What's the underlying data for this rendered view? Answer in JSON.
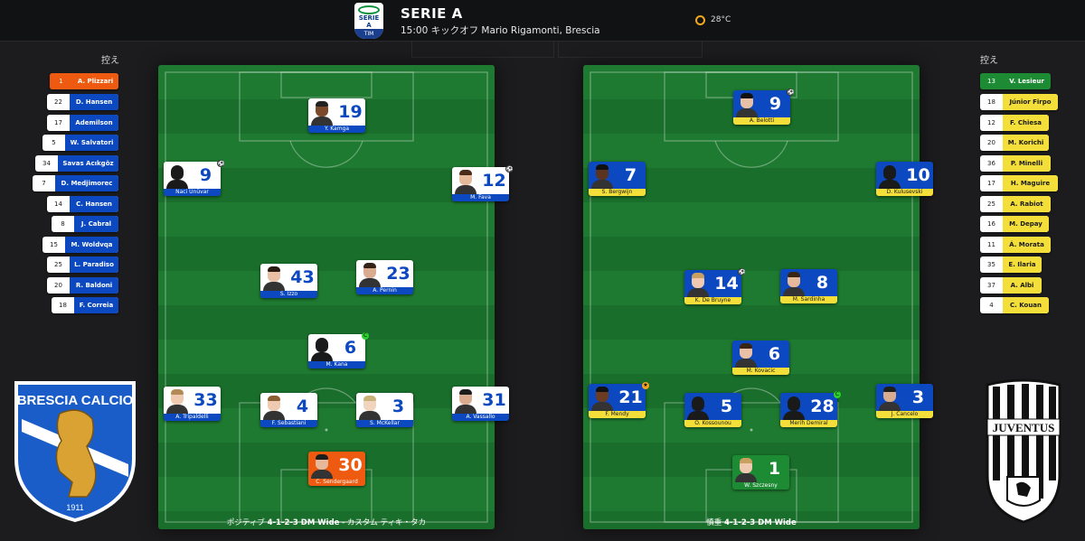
{
  "header": {
    "competition": "SERIE A",
    "kickoff": "15:00 キックオフ Mario Rigamonti, Brescia",
    "temperature": "28°C",
    "league_logo_text": "SERIE A",
    "league_logo_sponsor": "TIM"
  },
  "home": {
    "bench_label": "控え",
    "crest_text": "BRESCIA CALCIO",
    "crest_year": "1911",
    "formation_prefix": "ポジティブ",
    "formation": "4-1-2-3 DM Wide",
    "formation_suffix": "- カスタム ティキ・タカ",
    "subs": [
      {
        "num": "1",
        "name": "A. Plizzari",
        "style": "orange"
      },
      {
        "num": "22",
        "name": "D. Hansen",
        "style": "blue"
      },
      {
        "num": "17",
        "name": "Ademilson",
        "style": "blue"
      },
      {
        "num": "5",
        "name": "W. Salvatori",
        "style": "blue"
      },
      {
        "num": "34",
        "name": "Savas Acıkgöz",
        "style": "blue"
      },
      {
        "num": "7",
        "name": "D. Medjimorec",
        "style": "blue"
      },
      {
        "num": "14",
        "name": "C. Hansen",
        "style": "blue"
      },
      {
        "num": "8",
        "name": "J. Cabral",
        "style": "blue"
      },
      {
        "num": "15",
        "name": "M. Woldvqa",
        "style": "blue"
      },
      {
        "num": "25",
        "name": "L. Paradiso",
        "style": "blue"
      },
      {
        "num": "20",
        "name": "R. Baldoni",
        "style": "blue"
      },
      {
        "num": "18",
        "name": "F. Correia",
        "style": "blue"
      }
    ],
    "players": [
      {
        "num": "19",
        "name": "Y. Kamga"
      },
      {
        "num": "9",
        "name": "Naci Ünüvar"
      },
      {
        "num": "12",
        "name": "M. Fava"
      },
      {
        "num": "43",
        "name": "S. Izzo"
      },
      {
        "num": "23",
        "name": "A. Pernin"
      },
      {
        "num": "6",
        "name": "M. Kana"
      },
      {
        "num": "33",
        "name": "A. Tripaldelli"
      },
      {
        "num": "4",
        "name": "F. Sebastiani"
      },
      {
        "num": "3",
        "name": "S. McKellar"
      },
      {
        "num": "31",
        "name": "A. Vassallo"
      },
      {
        "num": "30",
        "name": "C. Sendergaard"
      }
    ]
  },
  "away": {
    "bench_label": "控え",
    "crest_text": "JUVENTUS",
    "formation_prefix": "慎重",
    "formation": "4-1-2-3 DM Wide",
    "subs": [
      {
        "num": "13",
        "name": "V. Lesieur",
        "style": "green"
      },
      {
        "num": "18",
        "name": "Júnior Firpo",
        "style": "yellow"
      },
      {
        "num": "12",
        "name": "F. Chiesa",
        "style": "yellow"
      },
      {
        "num": "20",
        "name": "M. Korichi",
        "style": "yellow"
      },
      {
        "num": "36",
        "name": "P. Minelli",
        "style": "yellow"
      },
      {
        "num": "17",
        "name": "H. Maguire",
        "style": "yellow"
      },
      {
        "num": "25",
        "name": "A. Rabiot",
        "style": "yellow"
      },
      {
        "num": "16",
        "name": "M. Depay",
        "style": "yellow"
      },
      {
        "num": "11",
        "name": "Á. Morata",
        "style": "yellow"
      },
      {
        "num": "35",
        "name": "E. Ilaria",
        "style": "yellow"
      },
      {
        "num": "37",
        "name": "A. Albi",
        "style": "yellow"
      },
      {
        "num": "4",
        "name": "C. Kouan",
        "style": "yellow"
      }
    ],
    "players": [
      {
        "num": "9",
        "name": "A. Belotti"
      },
      {
        "num": "7",
        "name": "S. Bergwijn"
      },
      {
        "num": "10",
        "name": "D. Kulusevski"
      },
      {
        "num": "14",
        "name": "K. De Bruyne"
      },
      {
        "num": "8",
        "name": "M. Sardinha"
      },
      {
        "num": "6",
        "name": "M. Kovacic"
      },
      {
        "num": "21",
        "name": "F. Mendy"
      },
      {
        "num": "5",
        "name": "O. Kossounou"
      },
      {
        "num": "28",
        "name": "Merih Demiral"
      },
      {
        "num": "3",
        "name": "J. Cancelo"
      },
      {
        "num": "1",
        "name": "W. Szczesny"
      }
    ]
  },
  "colors": {
    "home_primary": "#0c49c0",
    "away_primary": "#0c49c0",
    "away_secondary": "#f3de3a",
    "home_gk": "#ee5b10",
    "away_gk": "#1d8a34",
    "pitch": "#1f7a31"
  }
}
